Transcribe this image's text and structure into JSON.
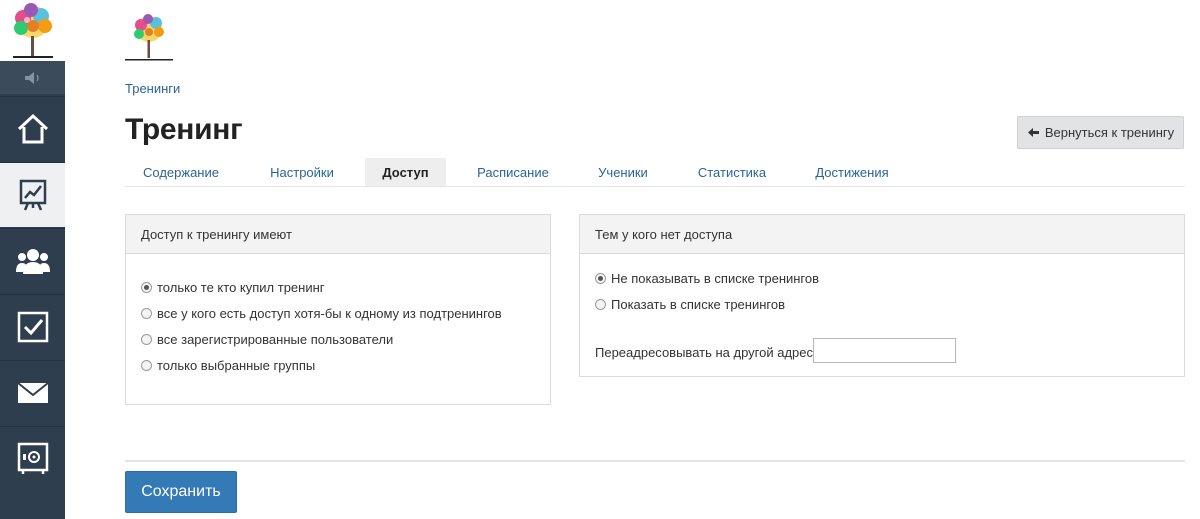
{
  "sidebar": {
    "items": [
      {
        "name": "home-icon"
      },
      {
        "name": "chart-board-icon",
        "active": true
      },
      {
        "name": "users-icon"
      },
      {
        "name": "checkbox-icon"
      },
      {
        "name": "mail-icon"
      },
      {
        "name": "safe-icon"
      }
    ],
    "colors": {
      "background": "#2f3e4e",
      "active": "#eef0f2"
    }
  },
  "breadcrumb": {
    "items": [
      "Тренинги"
    ]
  },
  "page": {
    "title": "Тренинг"
  },
  "header": {
    "back_label": "Вернуться к тренингу"
  },
  "tabs": [
    {
      "label": "Содержание"
    },
    {
      "label": "Настройки"
    },
    {
      "label": "Доступ",
      "active": true
    },
    {
      "label": "Расписание"
    },
    {
      "label": "Ученики"
    },
    {
      "label": "Статистика"
    },
    {
      "label": "Достижения"
    }
  ],
  "access_panel": {
    "title": "Доступ к тренингу имеют",
    "options": [
      {
        "label": "только те кто купил тренинг",
        "checked": true
      },
      {
        "label": "все у кого есть доступ хотя-бы к одному из подтренингов",
        "checked": false
      },
      {
        "label": "все зарегистрированные пользователи",
        "checked": false
      },
      {
        "label": "только выбранные группы",
        "checked": false
      }
    ]
  },
  "no_access_panel": {
    "title": "Тем у кого нет доступа",
    "options": [
      {
        "label": "Не показывать в списке тренингов",
        "checked": true
      },
      {
        "label": "Показать в списке тренингов",
        "checked": false
      }
    ],
    "redirect_label": "Переадресовывать на другой адрес",
    "redirect_value": ""
  },
  "footer": {
    "save_label": "Сохранить"
  },
  "colors": {
    "link": "#2a6496",
    "primary": "#337ab7"
  }
}
